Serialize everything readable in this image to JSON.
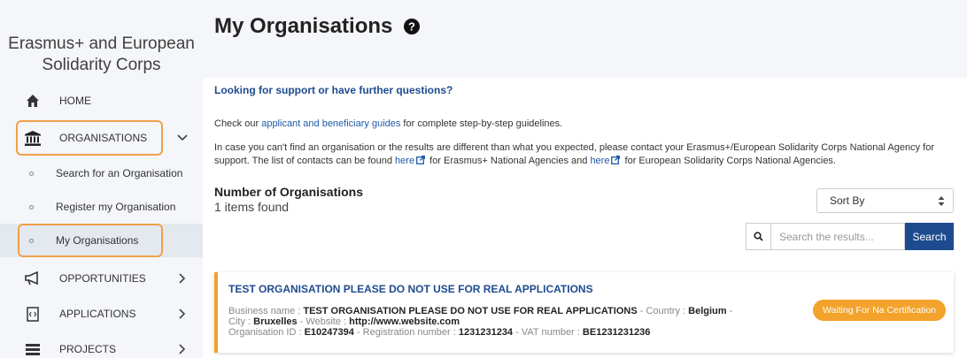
{
  "sidebar": {
    "brand": "Erasmus+ and European Solidarity Corps",
    "items": [
      {
        "label": "HOME",
        "icon": "home-icon"
      },
      {
        "label": "ORGANISATIONS",
        "icon": "institution-icon"
      },
      {
        "label": "OPPORTUNITIES",
        "icon": "megaphone-icon"
      },
      {
        "label": "APPLICATIONS",
        "icon": "document-icon"
      },
      {
        "label": "PROJECTS",
        "icon": "projects-icon"
      }
    ],
    "subitems": [
      {
        "label": "Search for an Organisation"
      },
      {
        "label": "Register my Organisation"
      },
      {
        "label": "My Organisations"
      }
    ]
  },
  "page": {
    "title": "My Organisations",
    "support_title": "Looking for support or have further questions?",
    "guide_prefix": "Check our ",
    "guide_link": "applicant and beneficiary guides",
    "guide_suffix": " for complete step-by-step guidelines.",
    "contact_text_1": "In case you can't find an organisation or the results are different than what you expected, please contact your Erasmus+/European Solidarity Corps National Agency for support. The list of contacts can be found ",
    "contact_link_1": "here",
    "contact_text_2": " for Erasmus+ National Agencies and ",
    "contact_link_2": "here",
    "contact_text_3": " for European Solidarity Corps National Agencies.",
    "count_title": "Number of Organisations",
    "count_sub": "1 items found"
  },
  "controls": {
    "sort_label": "Sort By",
    "search_placeholder": "Search the results...",
    "search_button": "Search"
  },
  "card": {
    "title": "TEST ORGANISATION PLEASE DO NOT USE FOR REAL APPLICATIONS",
    "business_name_label": "Business name : ",
    "business_name": "TEST ORGANISATION PLEASE DO NOT USE FOR REAL APPLICATIONS",
    "country_label": " - Country : ",
    "country": "Belgium",
    "sep": " -",
    "city_label": "City : ",
    "city": "Bruxelles",
    "website_label": " - Website : ",
    "website": "http://www.website.com",
    "org_id_label": "Organisation ID : ",
    "org_id": "E10247394",
    "reg_label": " - Registration number : ",
    "reg": "1231231234",
    "vat_label": " - VAT number : ",
    "vat": "BE1231231236",
    "status": "Waiting For Na Certification"
  },
  "colors": {
    "accent_orange": "#f3a22b",
    "primary_blue": "#1e4b8f",
    "highlight": "#f0a04b"
  }
}
